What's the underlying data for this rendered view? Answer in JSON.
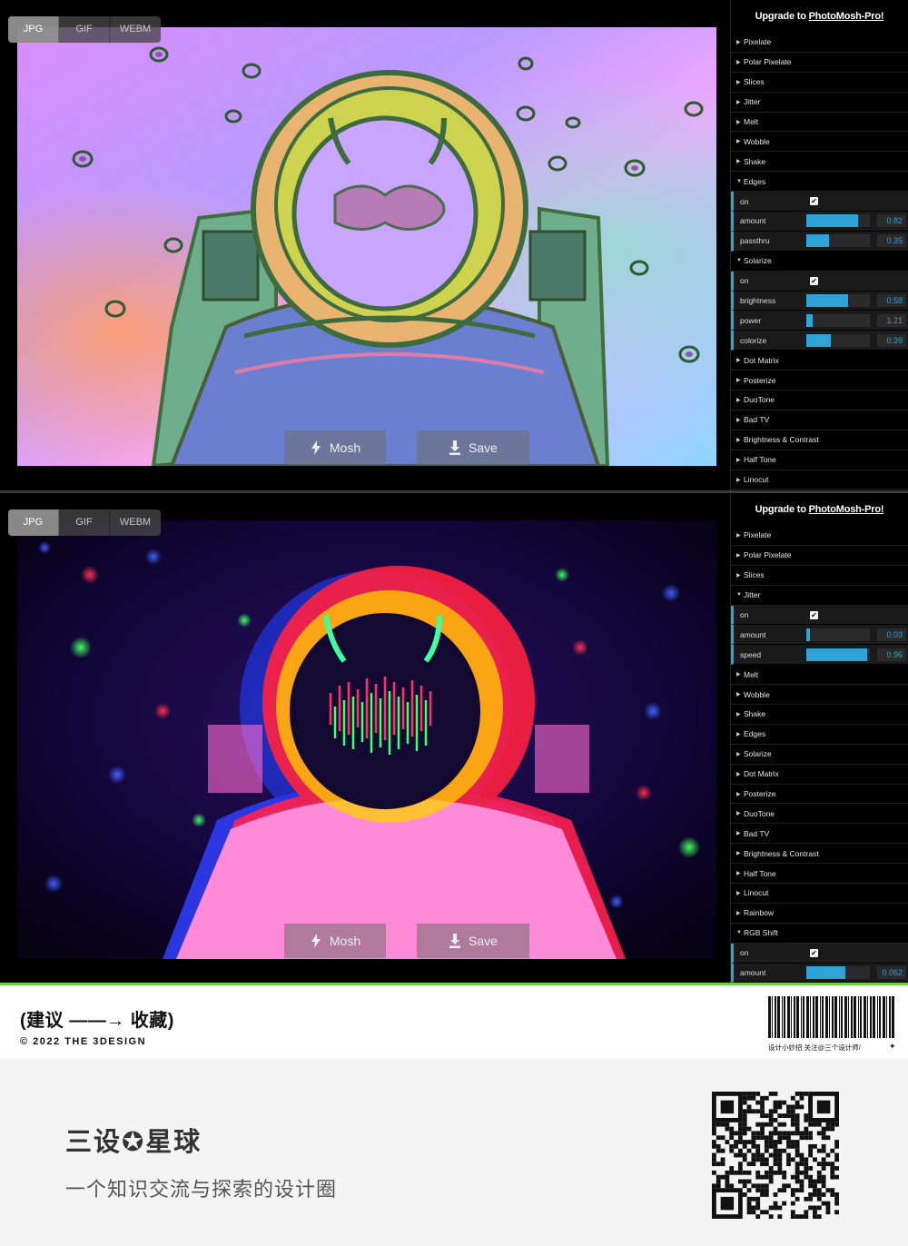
{
  "screens": [
    {
      "formats": [
        "JPG",
        "GIF",
        "WEBM"
      ],
      "active_format": "JPG",
      "actions": {
        "mosh": "Mosh",
        "save": "Save"
      },
      "upgrade_prefix": "Upgrade to ",
      "upgrade_link": "PhotoMosh-Pro!",
      "effects": [
        {
          "label": "Pixelate",
          "expanded": false
        },
        {
          "label": "Polar Pixelate",
          "expanded": false
        },
        {
          "label": "Slices",
          "expanded": false
        },
        {
          "label": "Jitter",
          "expanded": false
        },
        {
          "label": "Melt",
          "expanded": false
        },
        {
          "label": "Wobble",
          "expanded": false
        },
        {
          "label": "Shake",
          "expanded": false
        },
        {
          "label": "Edges",
          "expanded": true,
          "params": [
            {
              "label": "on",
              "type": "checkbox",
              "checked": true
            },
            {
              "label": "amount",
              "type": "slider",
              "value": "0.82",
              "level": 0.82
            },
            {
              "label": "passthru",
              "type": "slider",
              "value": "0.35",
              "level": 0.35
            }
          ]
        },
        {
          "label": "Solarize",
          "expanded": true,
          "params": [
            {
              "label": "on",
              "type": "checkbox",
              "checked": true
            },
            {
              "label": "brightness",
              "type": "slider",
              "value": "0.58",
              "level": 0.66
            },
            {
              "label": "power",
              "type": "slider",
              "value": "1.21",
              "level": 0.1
            },
            {
              "label": "colorize",
              "type": "slider",
              "value": "0.39",
              "level": 0.39
            }
          ]
        },
        {
          "label": "Dot Matrix",
          "expanded": false
        },
        {
          "label": "Posterize",
          "expanded": false
        },
        {
          "label": "DuoTone",
          "expanded": false
        },
        {
          "label": "Bad TV",
          "expanded": false
        },
        {
          "label": "Brightness & Contrast",
          "expanded": false
        },
        {
          "label": "Half Tone",
          "expanded": false
        },
        {
          "label": "Linocut",
          "expanded": false
        }
      ]
    },
    {
      "formats": [
        "JPG",
        "GIF",
        "WEBM"
      ],
      "active_format": "JPG",
      "actions": {
        "mosh": "Mosh",
        "save": "Save"
      },
      "upgrade_prefix": "Upgrade to ",
      "upgrade_link": "PhotoMosh-Pro!",
      "effects": [
        {
          "label": "Pixelate",
          "expanded": false
        },
        {
          "label": "Polar Pixelate",
          "expanded": false
        },
        {
          "label": "Slices",
          "expanded": false
        },
        {
          "label": "Jitter",
          "expanded": true,
          "params": [
            {
              "label": "on",
              "type": "checkbox",
              "checked": true
            },
            {
              "label": "amount",
              "type": "slider",
              "value": "0.03",
              "level": 0.05
            },
            {
              "label": "speed",
              "type": "slider",
              "value": "0.96",
              "level": 0.96
            }
          ]
        },
        {
          "label": "Melt",
          "expanded": false
        },
        {
          "label": "Wobble",
          "expanded": false
        },
        {
          "label": "Shake",
          "expanded": false
        },
        {
          "label": "Edges",
          "expanded": false
        },
        {
          "label": "Solarize",
          "expanded": false
        },
        {
          "label": "Dot Matrix",
          "expanded": false
        },
        {
          "label": "Posterize",
          "expanded": false
        },
        {
          "label": "DuoTone",
          "expanded": false
        },
        {
          "label": "Bad TV",
          "expanded": false
        },
        {
          "label": "Brightness & Contrast",
          "expanded": false
        },
        {
          "label": "Half Tone",
          "expanded": false
        },
        {
          "label": "Linocut",
          "expanded": false
        },
        {
          "label": "Rainbow",
          "expanded": false
        },
        {
          "label": "RGB Shift",
          "expanded": true,
          "params": [
            {
              "label": "on",
              "type": "checkbox",
              "checked": true
            },
            {
              "label": "amount",
              "type": "slider",
              "value": "0.062",
              "level": 0.62
            }
          ]
        }
      ]
    }
  ],
  "footer": {
    "tagline": "(建议 ——→ 收藏)",
    "copyright": "© 2022 THE 3DESIGN",
    "barcode_caption": "设计小妙招  关注@三个设计师/",
    "barcode_mark": "✦",
    "brand": "三设✪星球",
    "brand_sub": "一个知识交流与探索的设计圈"
  },
  "colors": {
    "accent": "#2fa3d6",
    "footer_stripe": "#6fd14b"
  },
  "icons": {
    "mosh": "lightning-icon",
    "save": "download-icon",
    "expand": "triangle-icon"
  }
}
